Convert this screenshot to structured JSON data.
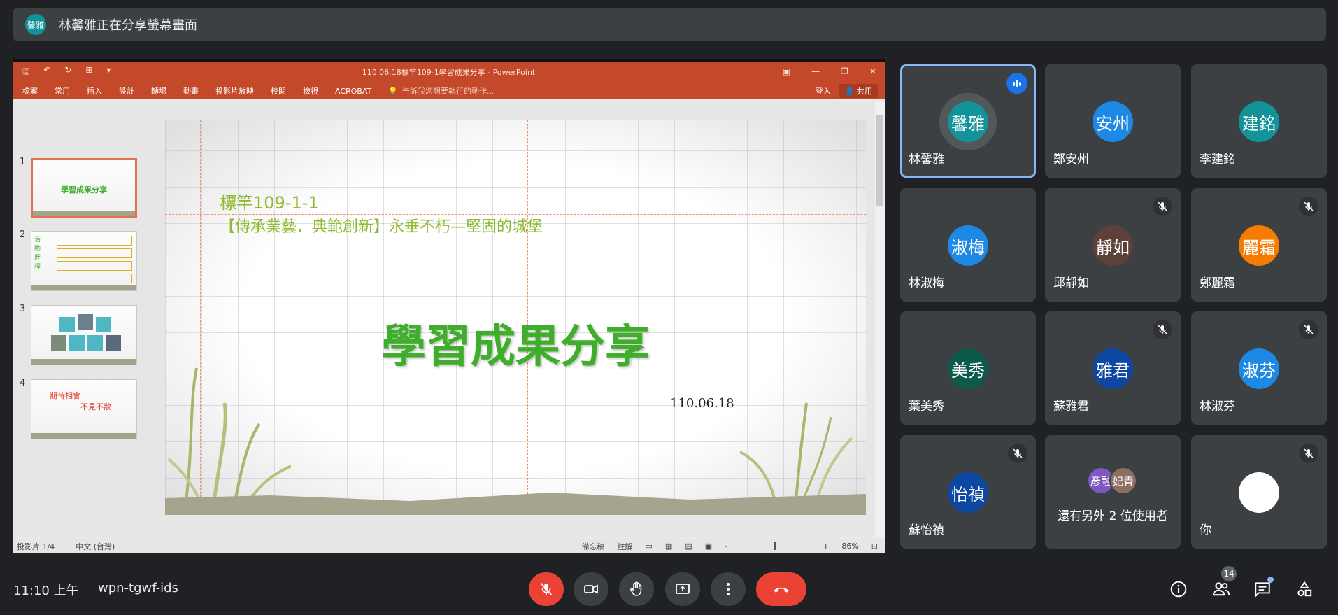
{
  "banner": {
    "avatar_initials": "馨雅",
    "text": "林馨雅正在分享螢幕畫面"
  },
  "powerpoint": {
    "window_title": "110.06.18標竿109-1學習成果分享 - PowerPoint",
    "ribbon_tabs": [
      "檔案",
      "常用",
      "插入",
      "設計",
      "轉場",
      "動畫",
      "投影片放映",
      "校閱",
      "檢視",
      "ACROBAT"
    ],
    "tell_me": "告訴我您想要執行的動作...",
    "sign_in": "登入",
    "share": "共用",
    "thumbnails": [
      {
        "num": "1",
        "title": "學習成果分享"
      },
      {
        "num": "2",
        "side_text": "活 動 歷 程"
      },
      {
        "num": "3"
      },
      {
        "num": "4",
        "line1": "期待相會",
        "line2": "不見不散"
      }
    ],
    "slide": {
      "subtitle1": "標竿109-1-1",
      "subtitle2": "【傳承業藝．典範創新】永垂不朽—堅固的城堡",
      "title": "學習成果分享",
      "date": "110.06.18"
    },
    "status": {
      "slide_pos": "投影片 1/4",
      "language": "中文 (台灣)",
      "notes": "備忘稿",
      "comments": "註解",
      "zoom": "86%"
    }
  },
  "participants": [
    {
      "initials": "馨雅",
      "name": "林馨雅",
      "color": "#12939a",
      "speaking": true,
      "muted": false
    },
    {
      "initials": "安州",
      "name": "鄭安州",
      "color": "#1e88e5",
      "speaking": false,
      "muted": false
    },
    {
      "initials": "建銘",
      "name": "李建銘",
      "color": "#12939a",
      "speaking": false,
      "muted": false
    },
    {
      "initials": "淑梅",
      "name": "林淑梅",
      "color": "#1e88e5",
      "speaking": false,
      "muted": false
    },
    {
      "initials": "靜如",
      "name": "邱靜如",
      "color": "#5d4037",
      "speaking": false,
      "muted": true
    },
    {
      "initials": "麗霜",
      "name": "鄭麗霜",
      "color": "#f57c00",
      "speaking": false,
      "muted": true
    },
    {
      "initials": "美秀",
      "name": "葉美秀",
      "color": "#0b5a4a",
      "speaking": false,
      "muted": false
    },
    {
      "initials": "雅君",
      "name": "蘇雅君",
      "color": "#0d47a1",
      "speaking": false,
      "muted": true
    },
    {
      "initials": "淑芬",
      "name": "林淑芬",
      "color": "#1e88e5",
      "speaking": false,
      "muted": true
    },
    {
      "initials": "怡禎",
      "name": "蘇怡禎",
      "color": "#0d47a1",
      "speaking": false,
      "muted": true
    }
  ],
  "others": {
    "avatars": [
      {
        "initials": "彥融",
        "color": "#7e57c2"
      },
      {
        "initials": "妃青",
        "color": "#8d6e63"
      }
    ],
    "label": "還有另外 2 位使用者"
  },
  "self_tile": {
    "name": "你",
    "muted": true
  },
  "bottom_bar": {
    "time": "11:10 上午",
    "meeting_code": "wpn-tgwf-ids",
    "people_count": "14"
  },
  "colors": {
    "hangup": "#ea4335",
    "speaking_outline": "#8ab4f8",
    "tile_bg": "#3c4043"
  }
}
